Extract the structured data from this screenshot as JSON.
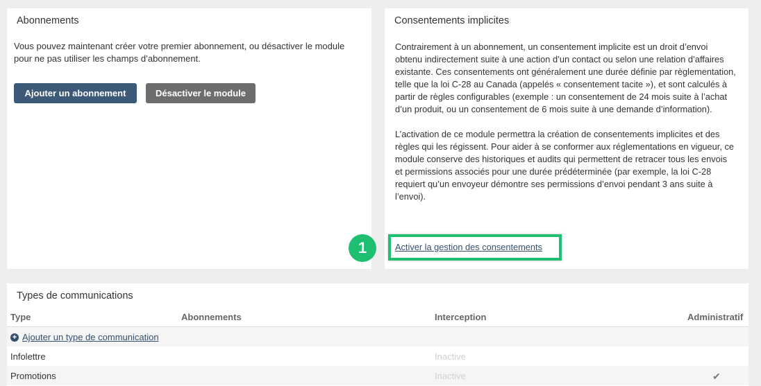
{
  "abonnements": {
    "title": "Abonnements",
    "text": "Vous pouvez maintenant créer votre premier abonnement, ou désactiver le module pour ne pas utiliser les champs d’abonnement.",
    "add_button": "Ajouter un abonnement",
    "disable_button": "Désactiver le module"
  },
  "consentements": {
    "title": "Consentements implicites",
    "paragraph1": "Contrairement à un abonnement, un consentement implicite est un droit d’envoi obtenu indirectement suite à une action d’un contact ou selon une relation d’affaires existante. Ces consentements ont généralement une durée définie par règlementation, telle que la loi C-28 au Canada (appelés « consentement tacite »), et sont calculés à partir de règles configurables (exemple : un consentement de 24 mois suite à l’achat d’un produit, ou un consentement de 6 mois suite à une demande d’information).",
    "paragraph2": "L’activation de ce module permettra la création de consentements implicites et des règles qui les régissent. Pour aider à se conformer aux réglementations en vigueur, ce module conserve des historiques et audits qui permettent de retracer tous les envois et permissions associés pour une durée prédéterminée (par exemple, la loi C-28  requiert qu’un envoyeur démontre ses permissions d’envoi pendant 3 ans suite à l’envoi).",
    "activate_link": "Activer la gestion des consentements",
    "badge": "1"
  },
  "types": {
    "title": "Types de communications",
    "columns": [
      "Type",
      "Abonnements",
      "Interception",
      "Administratif"
    ],
    "add_link": "Ajouter un type de communication",
    "rows": [
      {
        "type": "Infolettre",
        "interception": "Inactive",
        "admin_check": ""
      },
      {
        "type": "Promotions",
        "interception": "Inactive",
        "admin_check": "✔"
      }
    ]
  },
  "colors": {
    "accent_green": "#1fbf72",
    "primary_button": "#3c5a78",
    "secondary_button": "#6d6d6d"
  }
}
